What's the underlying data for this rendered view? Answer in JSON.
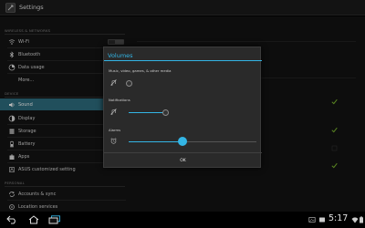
{
  "window": {
    "title": "Settings"
  },
  "sidebar": {
    "sections": [
      {
        "header": "WIRELESS & NETWORKS"
      },
      {
        "header": "DEVICE"
      },
      {
        "header": "PERSONAL"
      }
    ],
    "items": [
      {
        "label": "Wi-Fi",
        "icon": "wifi-icon",
        "toggle": "ON"
      },
      {
        "label": "Bluetooth",
        "icon": "bluetooth-icon",
        "toggle": "ON"
      },
      {
        "label": "Data usage",
        "icon": "data-usage-icon"
      },
      {
        "label": "More...",
        "icon": ""
      },
      {
        "label": "Sound",
        "icon": "speaker-icon",
        "selected": true
      },
      {
        "label": "Display",
        "icon": "display-icon"
      },
      {
        "label": "Storage",
        "icon": "storage-icon"
      },
      {
        "label": "Battery",
        "icon": "battery-icon"
      },
      {
        "label": "Apps",
        "icon": "apps-icon"
      },
      {
        "label": "ASUS customized setting",
        "icon": "asus-icon"
      },
      {
        "label": "Accounts & sync",
        "icon": "sync-icon"
      },
      {
        "label": "Location services",
        "icon": "location-icon"
      }
    ]
  },
  "dialog": {
    "title": "Volumes",
    "media": {
      "label": "Music, video, games, & other media",
      "level": 0.0
    },
    "notifications": {
      "label": "Notifications",
      "level": 0.29
    },
    "alarms": {
      "label": "Alarms",
      "level": 0.42
    },
    "ok_label": "OK"
  },
  "statusbar": {
    "time": "5:17"
  },
  "colors": {
    "accent": "#33b5e5",
    "selected_row": "#2e6e80"
  }
}
